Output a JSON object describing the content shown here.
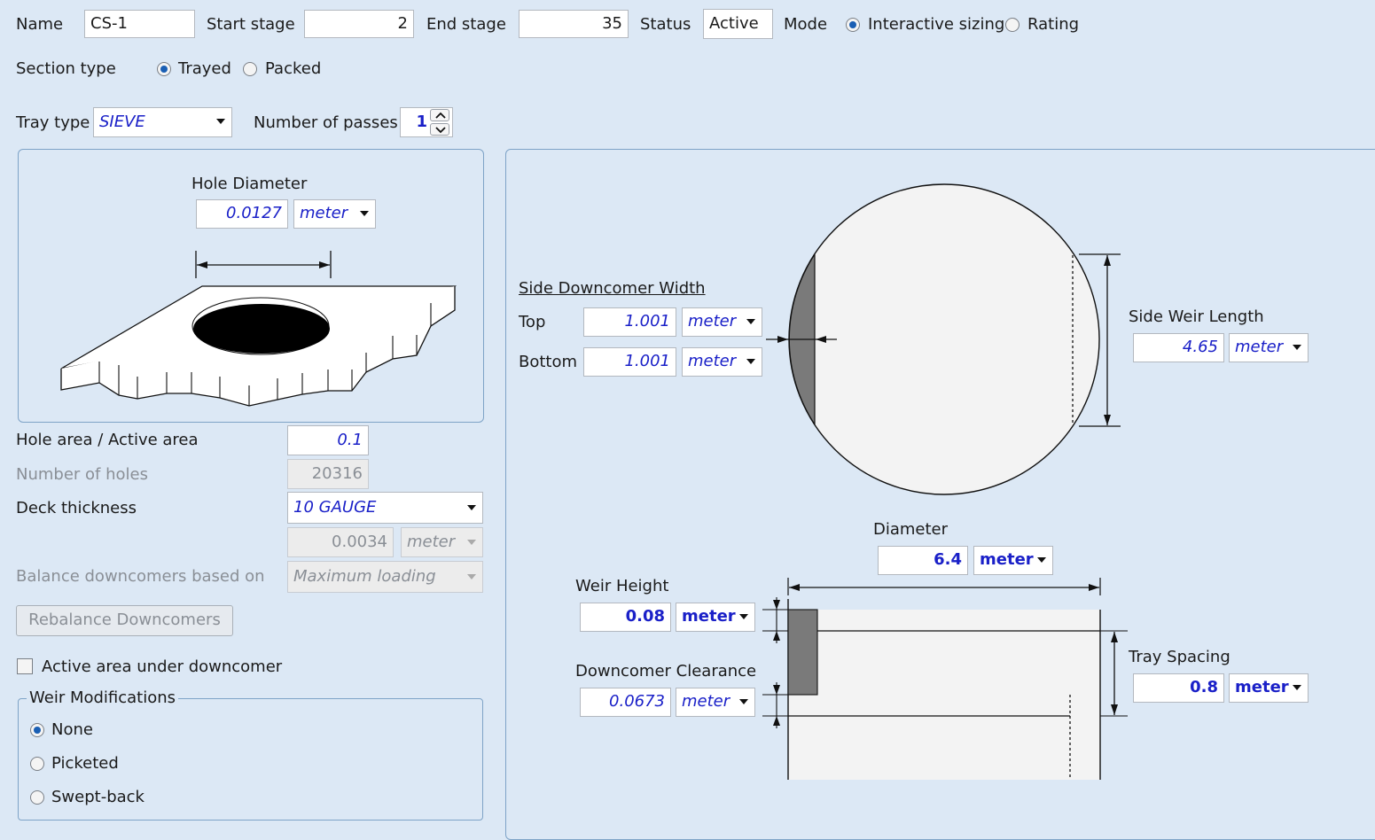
{
  "header": {
    "name_label": "Name",
    "name_value": "CS-1",
    "start_label": "Start stage",
    "start_value": "2",
    "end_label": "End stage",
    "end_value": "35",
    "status_label": "Status",
    "status_value": "Active",
    "mode_label": "Mode",
    "mode_options": [
      "Interactive sizing",
      "Rating"
    ],
    "mode_selected": "Interactive sizing"
  },
  "section": {
    "label": "Section type",
    "options": [
      "Trayed",
      "Packed"
    ],
    "selected": "Trayed"
  },
  "tray": {
    "type_label": "Tray type",
    "type_value": "SIEVE",
    "passes_label": "Number of passes",
    "passes_value": "1"
  },
  "hole": {
    "title": "Hole Diameter",
    "value": "0.0127",
    "unit": "meter"
  },
  "props": {
    "hole_area_label": "Hole area / Active area",
    "hole_area_value": "0.1",
    "holes_label": "Number of holes",
    "holes_value": "20316",
    "deck_label": "Deck thickness",
    "deck_value": "10 GAUGE",
    "deck_thick_value": "0.0034",
    "deck_thick_unit": "meter",
    "balance_label": "Balance downcomers based on",
    "balance_value": "Maximum loading",
    "rebalance_button": "Rebalance Downcomers",
    "active_area_label": "Active area under downcomer"
  },
  "weir_mods": {
    "title": "Weir Modifications",
    "options": [
      "None",
      "Picketed",
      "Swept-back"
    ],
    "selected": "None"
  },
  "diagram": {
    "sdw_title": "Side Downcomer Width",
    "top_label": "Top",
    "top_value": "1.001",
    "top_unit": "meter",
    "bottom_label": "Bottom",
    "bottom_value": "1.001",
    "bottom_unit": "meter",
    "swl_label": "Side Weir Length",
    "swl_value": "4.65",
    "swl_unit": "meter",
    "diameter_label": "Diameter",
    "diameter_value": "6.4",
    "diameter_unit": "meter",
    "weir_height_label": "Weir Height",
    "weir_height_value": "0.08",
    "weir_height_unit": "meter",
    "clearance_label": "Downcomer Clearance",
    "clearance_value": "0.0673",
    "clearance_unit": "meter",
    "tray_spacing_label": "Tray Spacing",
    "tray_spacing_value": "0.8",
    "tray_spacing_unit": "meter"
  }
}
